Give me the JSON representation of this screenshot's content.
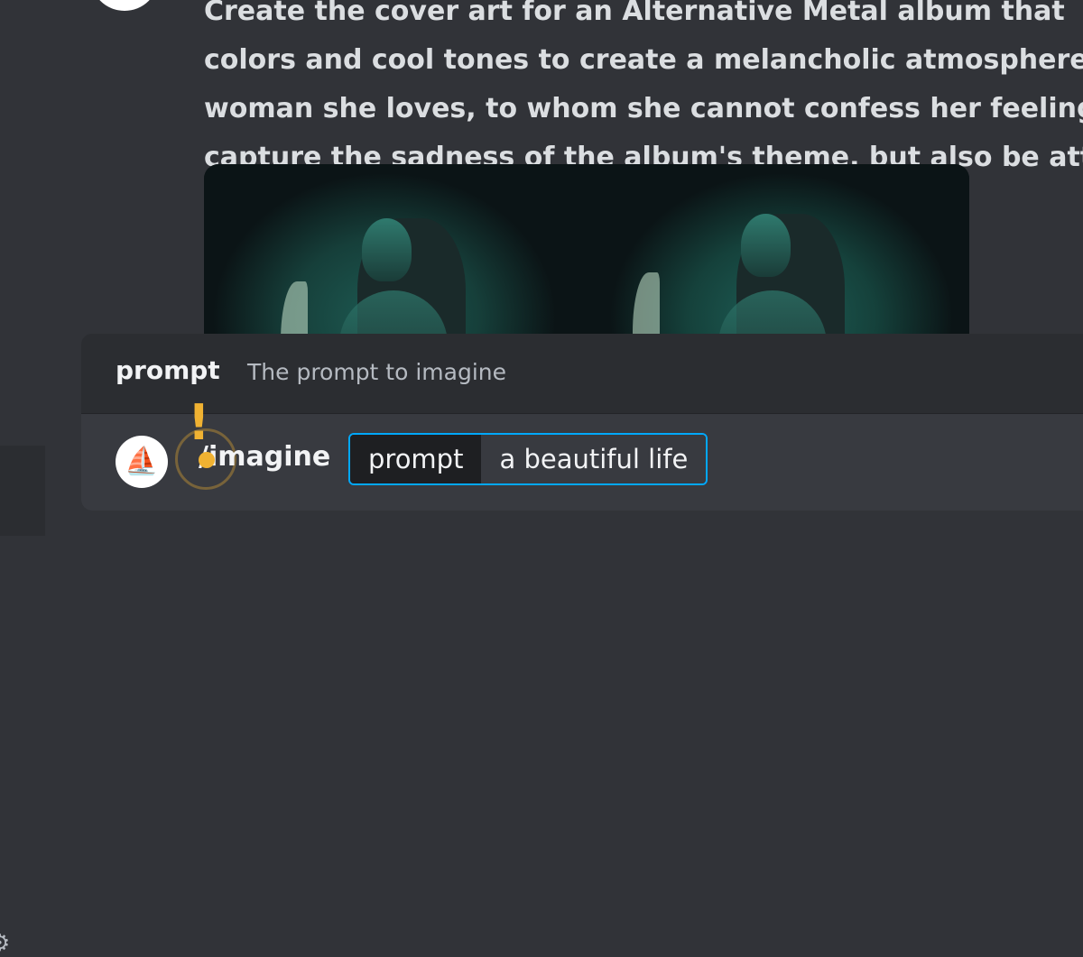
{
  "message": {
    "lines": [
      "Create the cover art for an Alternative Metal album that",
      "colors and cool tones to create a melancholic atmosphere",
      "woman she loves, to whom she cannot confess her feelings",
      "capture the sadness of the album's theme, but also be att"
    ]
  },
  "command_hint": {
    "option_name": "prompt",
    "option_description": "The prompt to imagine"
  },
  "command_input": {
    "command": "/imagine",
    "param_label": "prompt",
    "param_value": "a beautiful life"
  },
  "colors": {
    "background": "#313338",
    "panel": "#2b2d31",
    "input_row": "#383a40",
    "focus_border": "#00a8fc",
    "highlight": "#f0b232"
  },
  "icons": {
    "bot_avatar": "sailboat-icon",
    "settings": "gear-icon"
  }
}
